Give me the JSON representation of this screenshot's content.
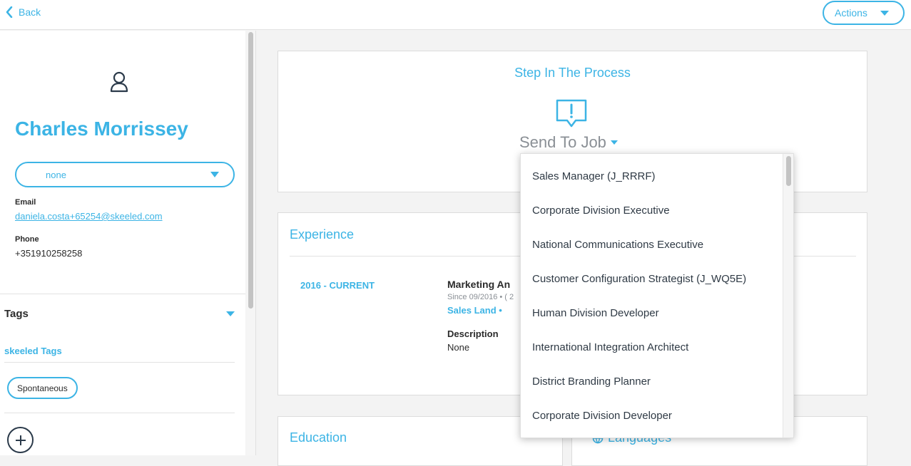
{
  "header": {
    "back_label": "Back",
    "actions_label": "Actions"
  },
  "candidate": {
    "name": "Charles Morrissey",
    "status": "none",
    "email_label": "Email",
    "email": "daniela.costa+65254@skeeled.com",
    "phone_label": "Phone",
    "phone": "+351910258258"
  },
  "tags": {
    "title": "Tags",
    "group": "skeeled Tags",
    "items": [
      "Spontaneous"
    ]
  },
  "step": {
    "title": "Step In The Process",
    "current": "Send To Job"
  },
  "experience": {
    "title": "Experience",
    "dates": "2016 - CURRENT",
    "role": "Marketing An",
    "since": "Since 09/2016 • ( 2",
    "company": "Sales Land •",
    "description_label": "Description",
    "description": "None"
  },
  "education": {
    "title": "Education"
  },
  "languages": {
    "title": "Languages"
  },
  "job_dropdown": {
    "options": [
      "Sales Manager (J_RRRF)",
      "Corporate Division Executive",
      "National Communications Executive",
      "Customer Configuration Strategist (J_WQ5E)",
      "Human Division Developer",
      "International Integration Architect",
      "District Branding Planner",
      "Corporate Division Developer"
    ]
  },
  "colors": {
    "accent": "#3cb4e5",
    "dark": "#2b2b2b",
    "muted": "#8a8f95"
  }
}
